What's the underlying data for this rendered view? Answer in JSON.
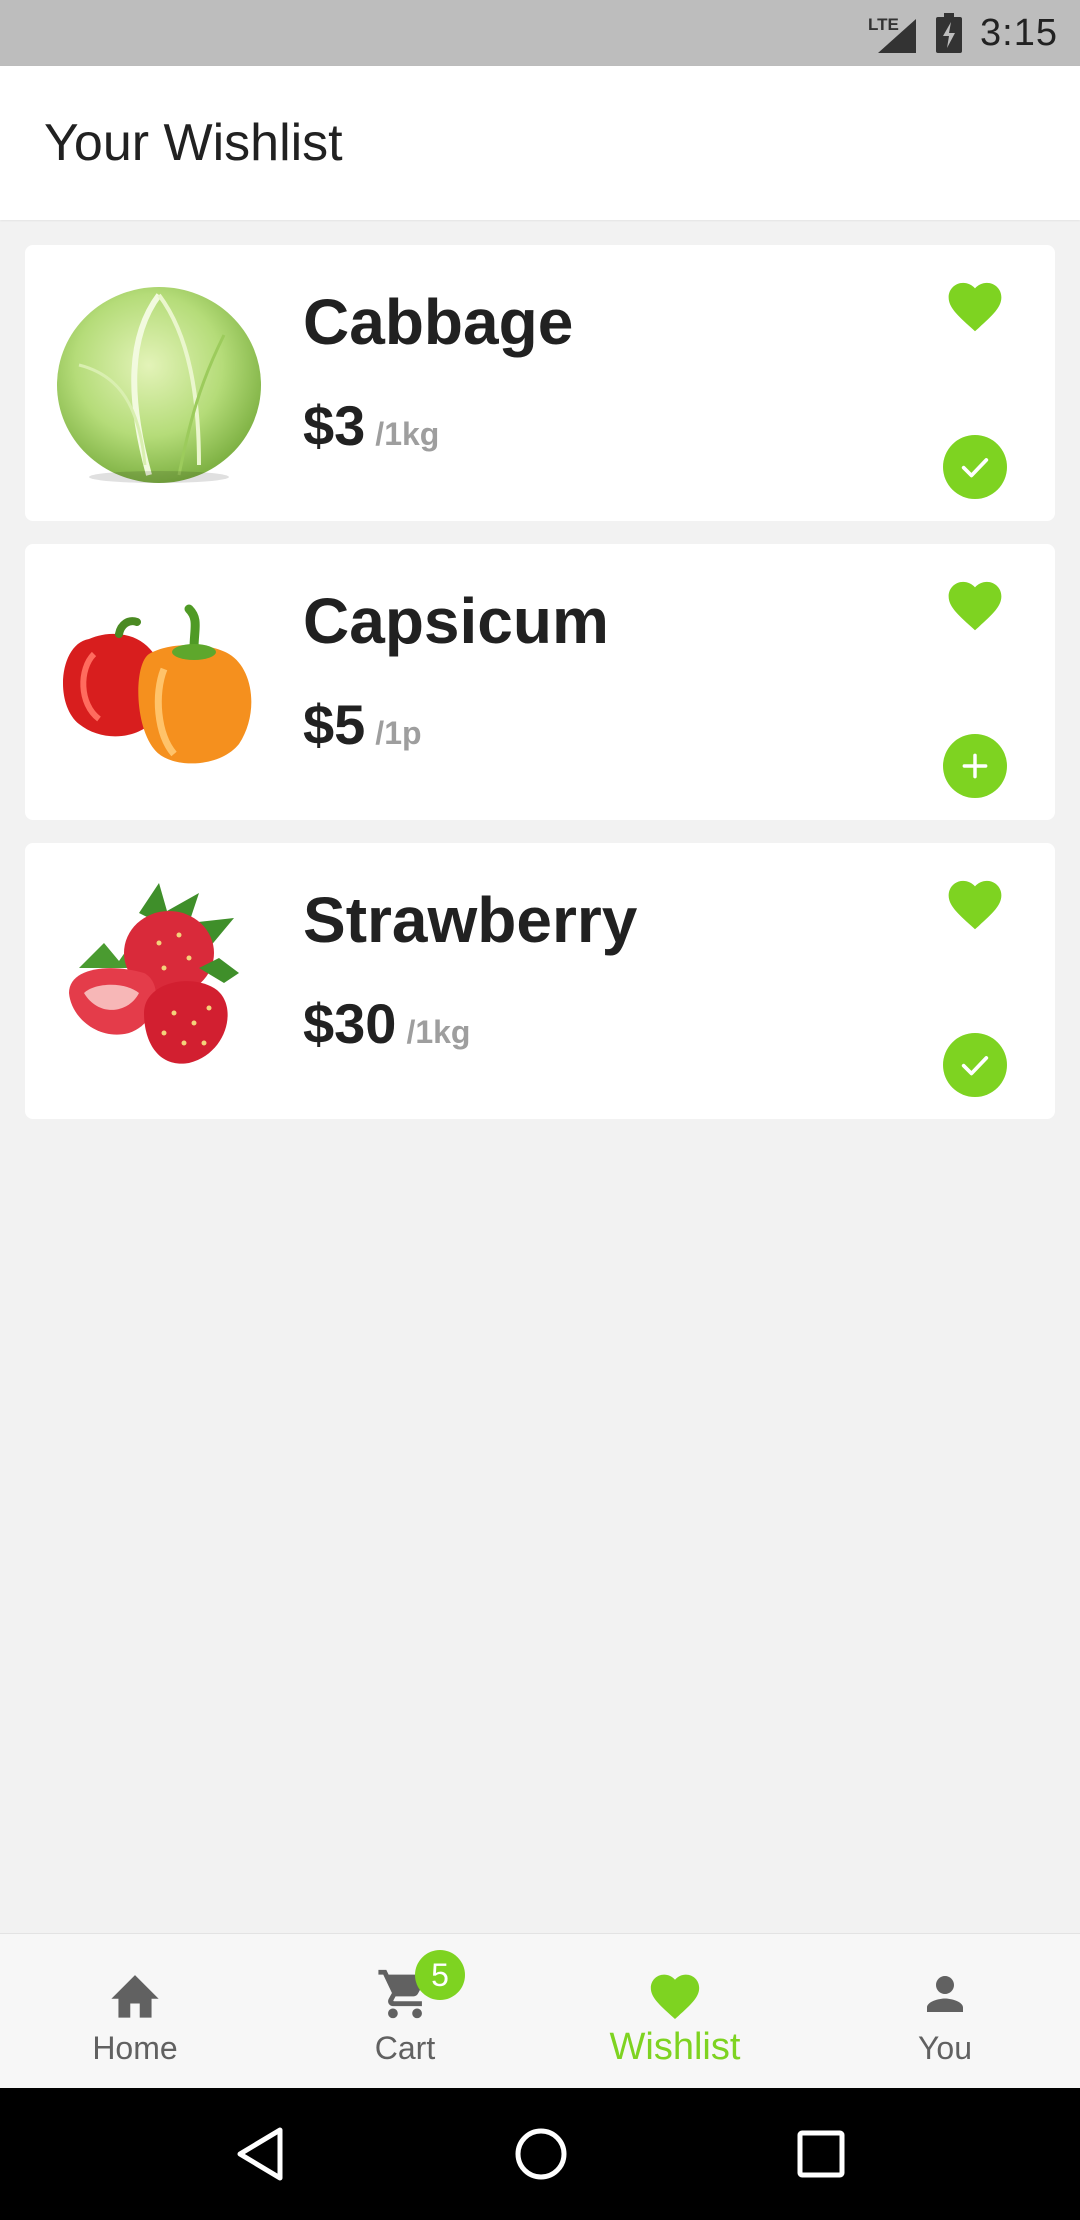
{
  "status_bar": {
    "network": "LTE",
    "time": "3:15"
  },
  "header": {
    "title": "Your Wishlist"
  },
  "wishlist": {
    "items": [
      {
        "name": "Cabbage",
        "price": "$3",
        "unit": "/1kg",
        "in_cart": true
      },
      {
        "name": "Capsicum",
        "price": "$5",
        "unit": "/1p",
        "in_cart": false
      },
      {
        "name": "Strawberry",
        "price": "$30",
        "unit": "/1kg",
        "in_cart": true
      }
    ]
  },
  "bottom_nav": {
    "items": [
      {
        "label": "Home",
        "icon": "home-icon"
      },
      {
        "label": "Cart",
        "icon": "cart-icon",
        "badge": "5"
      },
      {
        "label": "Wishlist",
        "icon": "heart-icon",
        "active": true
      },
      {
        "label": "You",
        "icon": "person-icon"
      }
    ]
  },
  "colors": {
    "accent": "#7ed321",
    "background": "#f2f2f2",
    "text": "#212121",
    "muted": "#9e9e9e"
  }
}
